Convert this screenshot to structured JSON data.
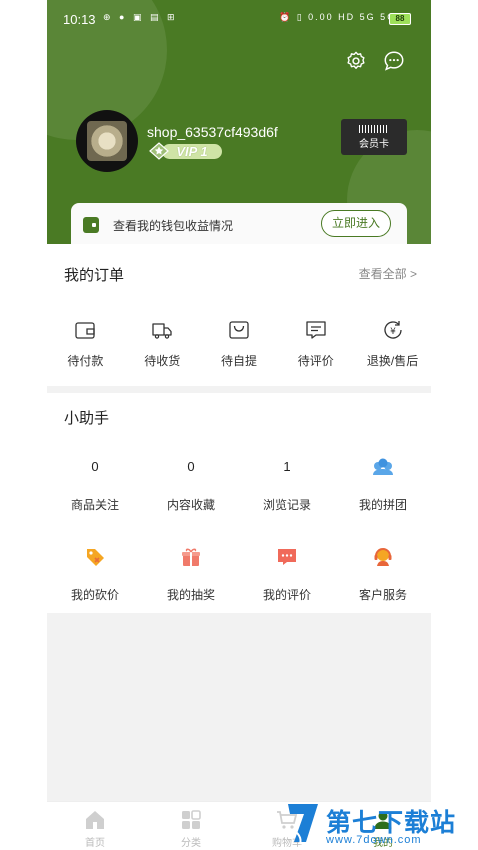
{
  "status_bar": {
    "time": "10:13",
    "left_icons": "⊕ ● ▣ ▤ ⊞",
    "right_icons": "⏰ ▯ 0.00 HD 5G 5G",
    "battery": "88"
  },
  "header": {
    "username": "shop_63537cf493d6f",
    "vip_label": "VIP 1",
    "member_card_label": "会员卡",
    "wallet_text": "查看我的钱包收益情况",
    "wallet_button": "立即进入",
    "accent_color": "#4a7a24"
  },
  "orders": {
    "title": "我的订单",
    "view_all": "查看全部 >",
    "items": [
      {
        "label": "待付款",
        "icon": "wallet-icon"
      },
      {
        "label": "待收货",
        "icon": "truck-icon"
      },
      {
        "label": "待自提",
        "icon": "bag-icon"
      },
      {
        "label": "待评价",
        "icon": "comment-icon"
      },
      {
        "label": "退换/售后",
        "icon": "refund-icon"
      }
    ]
  },
  "helper": {
    "title": "小助手",
    "row1": [
      {
        "value": "0",
        "label": "商品关注"
      },
      {
        "value": "0",
        "label": "内容收藏"
      },
      {
        "value": "1",
        "label": "浏览记录"
      },
      {
        "label": "我的拼团",
        "icon": "group-icon"
      }
    ],
    "row2": [
      {
        "label": "我的砍价",
        "icon": "tag-icon"
      },
      {
        "label": "我的抽奖",
        "icon": "gift-icon"
      },
      {
        "label": "我的评价",
        "icon": "review-icon"
      },
      {
        "label": "客户服务",
        "icon": "service-icon"
      }
    ]
  },
  "tabbar": {
    "items": [
      {
        "label": "首页",
        "icon": "home-icon"
      },
      {
        "label": "分类",
        "icon": "category-icon"
      },
      {
        "label": "购物车",
        "icon": "cart-icon"
      },
      {
        "label": "我的",
        "icon": "profile-icon"
      }
    ]
  },
  "watermark": {
    "text": "第七下载站",
    "url": "www.7down.com"
  }
}
